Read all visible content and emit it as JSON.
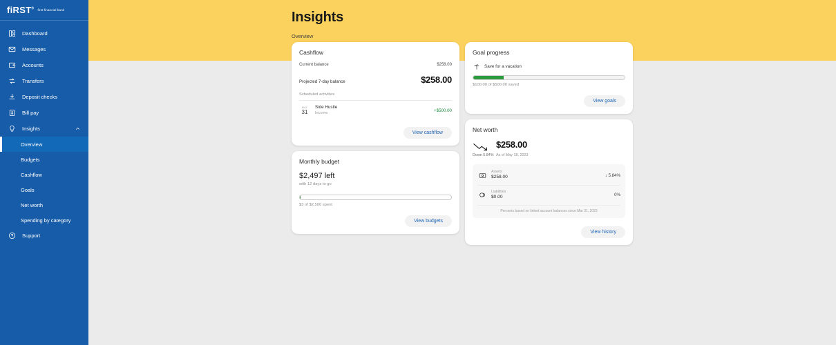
{
  "brand": {
    "logo_main": "fiRST",
    "logo_tm": "®",
    "logo_sub": "first financial bank"
  },
  "colors": {
    "sidebar": "#175CA8",
    "sidebar_active": "#1169B8",
    "hero": "#FBD25D",
    "page_bg": "#ebebeb",
    "link": "#1c63b5",
    "positive": "#1c8a3c",
    "progress_green": "#2e9a3e"
  },
  "sidebar": {
    "items": [
      {
        "label": "Dashboard",
        "icon": "dashboard-icon"
      },
      {
        "label": "Messages",
        "icon": "envelope-icon"
      },
      {
        "label": "Accounts",
        "icon": "wallet-icon"
      },
      {
        "label": "Transfers",
        "icon": "transfer-arrows-icon"
      },
      {
        "label": "Deposit checks",
        "icon": "deposit-icon"
      },
      {
        "label": "Bill pay",
        "icon": "bill-icon"
      },
      {
        "label": "Insights",
        "icon": "lightbulb-icon",
        "expanded": true
      }
    ],
    "insights_subitems": [
      {
        "label": "Overview",
        "active": true
      },
      {
        "label": "Budgets",
        "active": false
      },
      {
        "label": "Cashflow",
        "active": false
      },
      {
        "label": "Goals",
        "active": false
      },
      {
        "label": "Net worth",
        "active": false
      },
      {
        "label": "Spending by category",
        "active": false
      }
    ],
    "support": {
      "label": "Support",
      "icon": "help-circle-icon"
    }
  },
  "header": {
    "title": "Insights",
    "breadcrumb": "Overview"
  },
  "cashflow_card": {
    "title": "Cashflow",
    "current_balance_label": "Current balance",
    "current_balance_value": "$258.00",
    "projected_label": "Projected 7-day balance",
    "projected_value": "$258.00",
    "scheduled_label": "Scheduled activities",
    "activity": {
      "month": "MAY",
      "day": "31",
      "name": "Side Hustle",
      "type": "Income",
      "amount": "+$500.00"
    },
    "button": "View cashflow"
  },
  "budget_card": {
    "title": "Monthly budget",
    "left_amount": "$2,497 left",
    "days_to_go": "with 12 days to go",
    "spent_label": "$3 of $2,500 spent",
    "progress_percent": 0.12
  },
  "goal_card": {
    "title": "Goal progress",
    "goal_name": "Save for a vacation",
    "goal_icon": "palm-tree-icon",
    "saved_label": "$100.00 of $500.00 saved",
    "progress_percent": 20,
    "button": "View goals"
  },
  "networth_card": {
    "title": "Net worth",
    "trend_icon": "trend-down-arrow-icon",
    "trend_label": "Down 5.84%",
    "amount": "$258.00",
    "as_of": "As of May 18, 2023",
    "rows": [
      {
        "icon": "banknote-icon",
        "label": "Assets",
        "value": "$258.00",
        "percent": "5.84%",
        "direction": "down"
      },
      {
        "icon": "coins-icon",
        "label": "Liabilities",
        "value": "$0.00",
        "percent": "0%",
        "direction": "none"
      }
    ],
    "footnote": "Percents based on linked account balances since Mar 31, 2023",
    "button": "View history"
  }
}
